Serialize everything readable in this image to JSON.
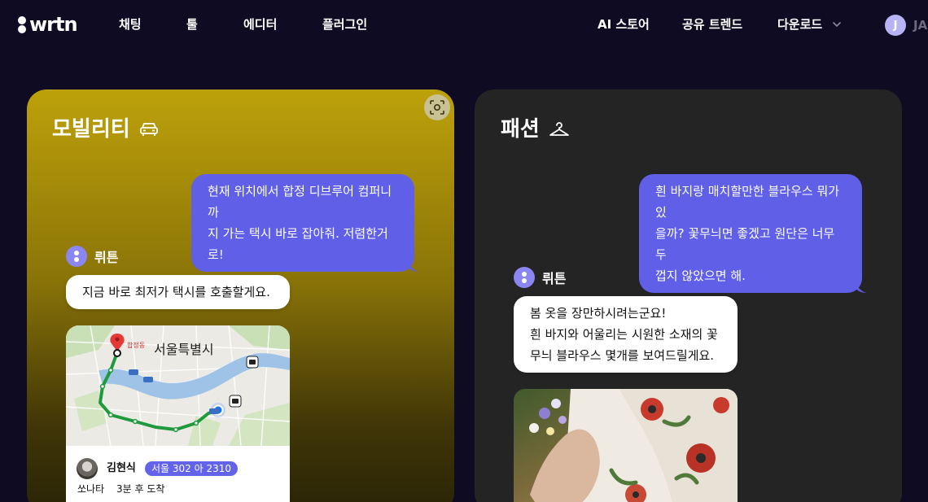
{
  "nav": {
    "logo": "wrtn",
    "items": [
      "채팅",
      "툴",
      "에디터",
      "플러그인"
    ],
    "right_items": [
      "AI 스토어",
      "공유 트렌드",
      "다운로드"
    ],
    "avatar_initial": "J",
    "user_name": "JA"
  },
  "cards": [
    {
      "title": "모빌리티",
      "title_icon": "car-icon",
      "user_message_lines": [
        "현재 위치에서 합정 디브루어 컴퍼니까",
        "지 가는 택시 바로 잡아줘. 저렴한거로!"
      ],
      "bot_name": "뤼튼",
      "bot_reply_lines": [
        "지금 바로 최저가 택시를 호출할게요."
      ],
      "map": {
        "city_label": "서울특별시",
        "pin_label": "합정동"
      },
      "driver": {
        "name": "김현식",
        "plate": "서울 302 아 2310",
        "car_model": "쏘나타",
        "eta": "3분 후 도착"
      }
    },
    {
      "title": "패션",
      "title_icon": "hanger-icon",
      "user_message_lines": [
        "흰 바지랑 매치할만한 블라우스 뭐가있",
        "을까? 꽃무늬면 좋겠고 원단은 너무 두",
        "껍지 않았으면 해."
      ],
      "bot_name": "뤼튼",
      "bot_reply_lines": [
        "봄 옷을 장만하시려는군요!",
        "흰 바지와 어울리는 시원한 소재의 꽃",
        "무늬 블라우스 몇개를 보여드릴게요."
      ]
    }
  ],
  "colors": {
    "background": "#0e0b23",
    "accent": "#5f5fe8",
    "mobility_card": "#bda10a",
    "fashion_card": "#242424"
  }
}
